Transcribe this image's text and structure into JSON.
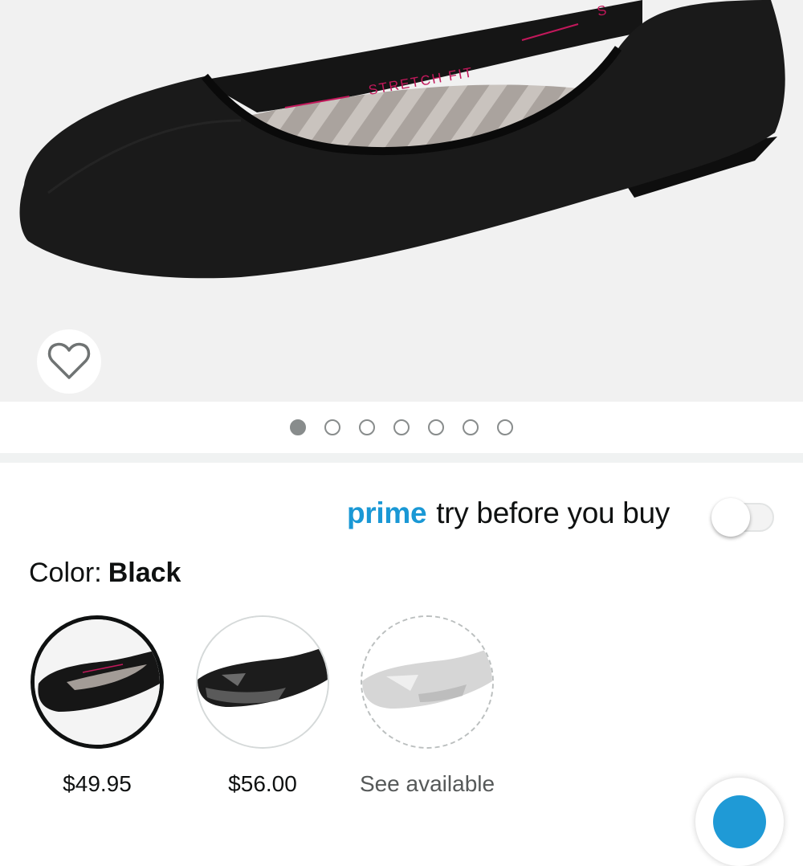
{
  "hero": {
    "image_name": "black-knit-ballet-flat",
    "insole_print": "STRETCH FIT",
    "insole_print_2": "FIT",
    "wishlist_icon": "heart-outline-icon"
  },
  "carousel": {
    "total_images": 7,
    "active_index": 0
  },
  "prime": {
    "brand": "prime",
    "label": "try before you buy",
    "brand_color": "#1a98d5",
    "toggle_on": false
  },
  "color": {
    "label": "Color:",
    "selected": "Black"
  },
  "swatches": [
    {
      "name": "Black",
      "price": "$49.95",
      "selected": true
    },
    {
      "name": "Black / Grey",
      "price": "$56.00",
      "selected": false
    },
    {
      "name": "Light Grey",
      "price": "See available",
      "selected": false
    }
  ],
  "accent": "#1f9ad6"
}
